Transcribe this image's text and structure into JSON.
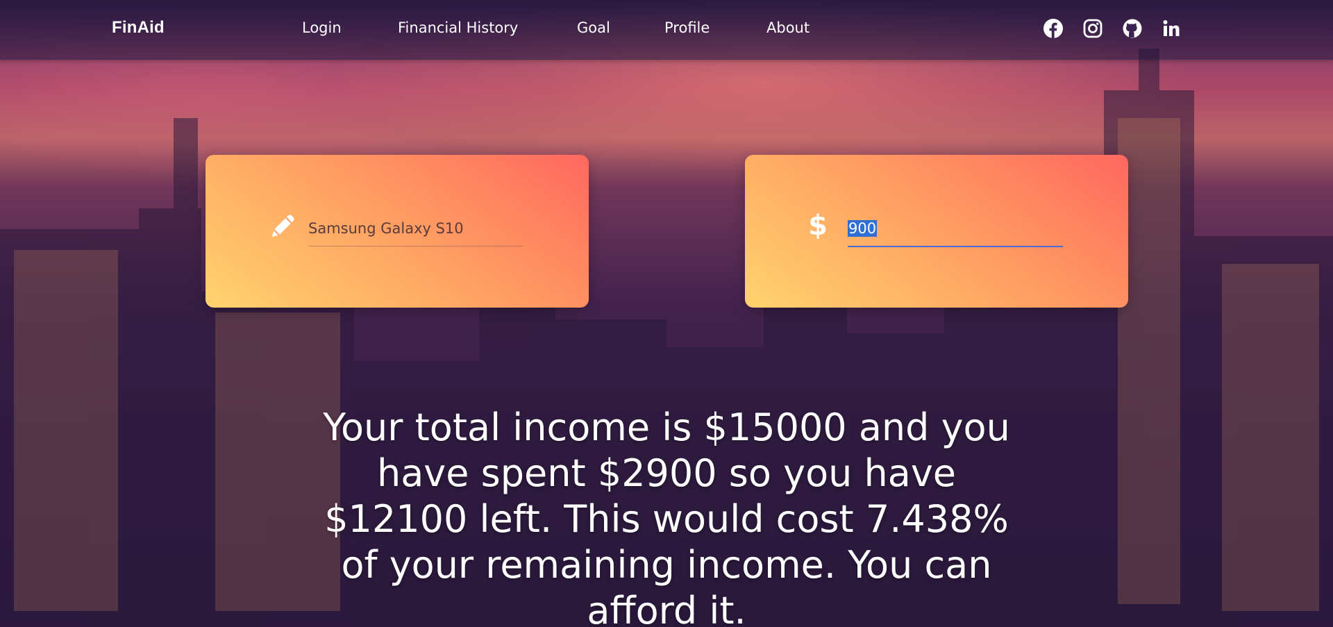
{
  "nav": {
    "brand": "FinAid",
    "links": [
      {
        "label": "Login"
      },
      {
        "label": "Financial History"
      },
      {
        "label": "Goal"
      },
      {
        "label": "Profile"
      },
      {
        "label": "About"
      }
    ],
    "social": [
      {
        "icon": "facebook-icon"
      },
      {
        "icon": "instagram-icon"
      },
      {
        "icon": "github-icon"
      },
      {
        "icon": "linkedin-icon"
      }
    ]
  },
  "item_card": {
    "icon": "pencil-icon",
    "value": "Samsung Galaxy S10"
  },
  "price_card": {
    "icon": "dollar-icon",
    "value": "900"
  },
  "result": {
    "message": "Your total income is $15000 and you have spent $2900 so you have $12100 left. This would cost 7.438% of your remaining income. You can afford it."
  },
  "colors": {
    "card_gradient_start": "#ffd36e",
    "card_gradient_end": "#ff6760",
    "focus_underline": "#4a6ad8",
    "selection": "#2d6fd4"
  }
}
